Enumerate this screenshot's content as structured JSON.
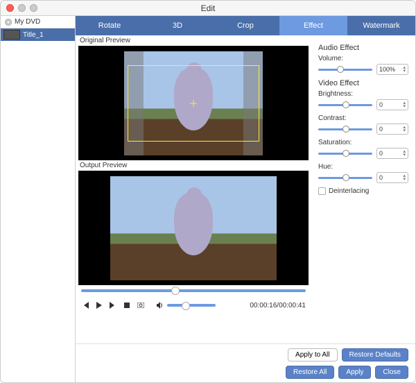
{
  "window": {
    "title": "Edit"
  },
  "sidebar": {
    "source": "My DVD",
    "items": [
      {
        "label": "Title_1"
      }
    ]
  },
  "tabs": [
    {
      "label": "Rotate"
    },
    {
      "label": "3D"
    },
    {
      "label": "Crop"
    },
    {
      "label": "Effect"
    },
    {
      "label": "Watermark"
    }
  ],
  "active_tab": 3,
  "previews": {
    "original_label": "Original Preview",
    "output_label": "Output Preview"
  },
  "playback": {
    "time": "00:00:16/00:00:41"
  },
  "panel": {
    "audio_header": "Audio Effect",
    "volume_label": "Volume:",
    "volume_value": "100%",
    "video_header": "Video Effect",
    "brightness_label": "Brightness:",
    "brightness_value": "0",
    "contrast_label": "Contrast:",
    "contrast_value": "0",
    "saturation_label": "Saturation:",
    "saturation_value": "0",
    "hue_label": "Hue:",
    "hue_value": "0",
    "deinterlacing_label": "Deinterlacing"
  },
  "buttons": {
    "apply_all": "Apply to All",
    "restore_defaults": "Restore Defaults",
    "restore_all": "Restore All",
    "apply": "Apply",
    "close": "Close"
  }
}
